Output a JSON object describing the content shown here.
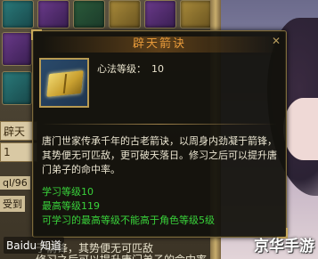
{
  "tooltip": {
    "title": "辟天箭诀",
    "level_label": "心法等级：",
    "level_value": "10",
    "description": "唐门世家传承千年的古老箭诀，以周身内劲凝于箭锋，其势便无可匹敌，更可破天落日。修习之后可以提升唐门弟子的命中率。",
    "learn_level": "学习等级10",
    "max_level": "最高等级119",
    "max_note": "可学习的最高等级不能高于角色等级5级",
    "close_glyph": "✕"
  },
  "background": {
    "side_tabs": [
      "辟天",
      "1"
    ],
    "side_texts": [
      "ql/96",
      "受到"
    ],
    "bottom_lines": [
      "于箭锋，其势便无可匹敌",
      "修习之后可以提升唐门弟子的命中率"
    ]
  },
  "watermarks": {
    "left": "Baidu 知道",
    "right": "京华手游"
  },
  "colors": {
    "title": "#e79a3a",
    "stat_green": "#39d23a",
    "frame_gold": "#c8a85a"
  },
  "icons": [
    "skill-book-icon",
    "close-icon"
  ]
}
